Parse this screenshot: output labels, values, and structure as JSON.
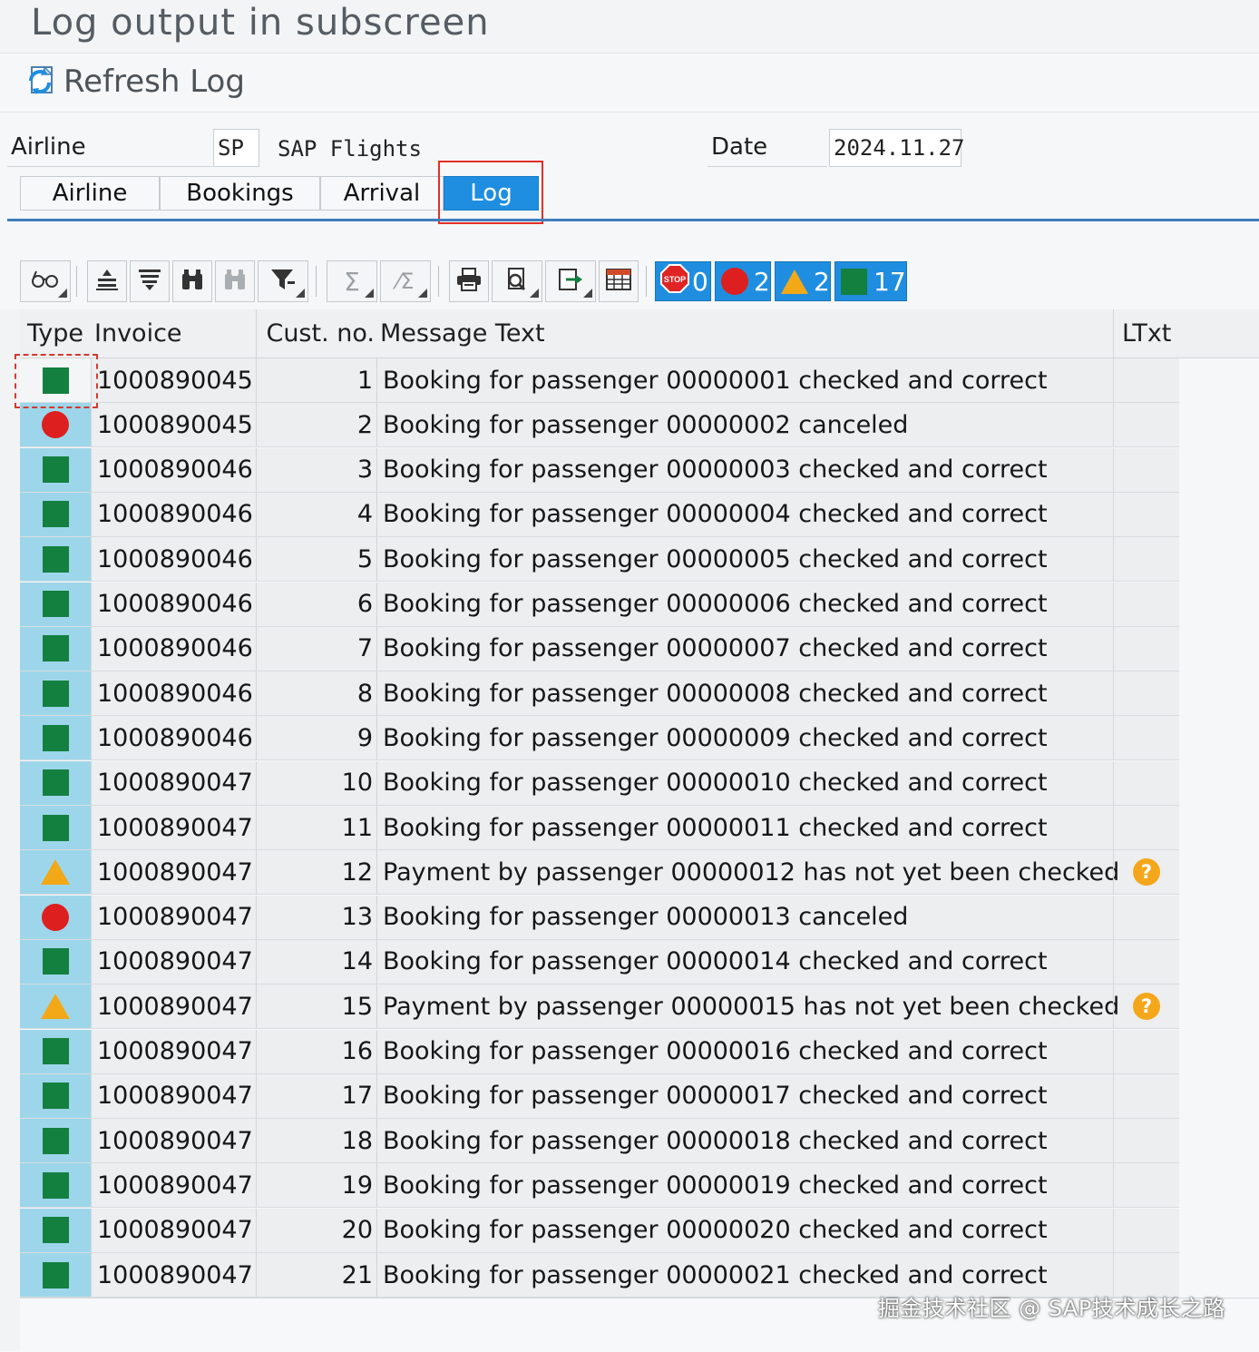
{
  "screen": {
    "title": "Log output in subscreen",
    "refresh_label": "Refresh Log"
  },
  "header": {
    "airline_label": "Airline",
    "airline_code": "SP",
    "airline_name": "SAP Flights",
    "date_label": "Date",
    "date_value": "2024.11.27"
  },
  "tabs": [
    {
      "label": "Airline",
      "active": false
    },
    {
      "label": "Bookings",
      "active": false
    },
    {
      "label": "Arrival",
      "active": false
    },
    {
      "label": "Log",
      "active": true
    }
  ],
  "toolbar": {
    "counters": {
      "stop": "0",
      "error": "2",
      "warning": "2",
      "success": "17"
    }
  },
  "grid": {
    "columns": [
      "Type",
      "Invoice",
      "Cust. no.",
      "Message Text",
      "LTxt"
    ],
    "rows": [
      {
        "type": "success",
        "invoice": "1000890045",
        "cust": "1",
        "message": "Booking for passenger 00000001 checked and correct",
        "ltxt": false
      },
      {
        "type": "error",
        "invoice": "1000890045",
        "cust": "2",
        "message": "Booking for passenger 00000002 canceled",
        "ltxt": false
      },
      {
        "type": "success",
        "invoice": "1000890046",
        "cust": "3",
        "message": "Booking for passenger 00000003 checked and correct",
        "ltxt": false
      },
      {
        "type": "success",
        "invoice": "1000890046",
        "cust": "4",
        "message": "Booking for passenger 00000004 checked and correct",
        "ltxt": false
      },
      {
        "type": "success",
        "invoice": "1000890046",
        "cust": "5",
        "message": "Booking for passenger 00000005 checked and correct",
        "ltxt": false
      },
      {
        "type": "success",
        "invoice": "1000890046",
        "cust": "6",
        "message": "Booking for passenger 00000006 checked and correct",
        "ltxt": false
      },
      {
        "type": "success",
        "invoice": "1000890046",
        "cust": "7",
        "message": "Booking for passenger 00000007 checked and correct",
        "ltxt": false
      },
      {
        "type": "success",
        "invoice": "1000890046",
        "cust": "8",
        "message": "Booking for passenger 00000008 checked and correct",
        "ltxt": false
      },
      {
        "type": "success",
        "invoice": "1000890046",
        "cust": "9",
        "message": "Booking for passenger 00000009 checked and correct",
        "ltxt": false
      },
      {
        "type": "success",
        "invoice": "1000890047",
        "cust": "10",
        "message": "Booking for passenger 00000010 checked and correct",
        "ltxt": false
      },
      {
        "type": "success",
        "invoice": "1000890047",
        "cust": "11",
        "message": "Booking for passenger 00000011 checked and correct",
        "ltxt": false
      },
      {
        "type": "warning",
        "invoice": "1000890047",
        "cust": "12",
        "message": "Payment by passenger 00000012 has not yet been checked",
        "ltxt": true
      },
      {
        "type": "error",
        "invoice": "1000890047",
        "cust": "13",
        "message": "Booking for passenger 00000013 canceled",
        "ltxt": false
      },
      {
        "type": "success",
        "invoice": "1000890047",
        "cust": "14",
        "message": "Booking for passenger 00000014 checked and correct",
        "ltxt": false
      },
      {
        "type": "warning",
        "invoice": "1000890047",
        "cust": "15",
        "message": "Payment by passenger 00000015 has not yet been checked",
        "ltxt": true
      },
      {
        "type": "success",
        "invoice": "1000890047",
        "cust": "16",
        "message": "Booking for passenger 00000016 checked and correct",
        "ltxt": false
      },
      {
        "type": "success",
        "invoice": "1000890047",
        "cust": "17",
        "message": "Booking for passenger 00000017 checked and correct",
        "ltxt": false
      },
      {
        "type": "success",
        "invoice": "1000890047",
        "cust": "18",
        "message": "Booking for passenger 00000018 checked and correct",
        "ltxt": false
      },
      {
        "type": "success",
        "invoice": "1000890047",
        "cust": "19",
        "message": "Booking for passenger 00000019 checked and correct",
        "ltxt": false
      },
      {
        "type": "success",
        "invoice": "1000890047",
        "cust": "20",
        "message": "Booking for passenger 00000020 checked and correct",
        "ltxt": false
      },
      {
        "type": "success",
        "invoice": "1000890047",
        "cust": "21",
        "message": "Booking for passenger 00000021 checked and correct",
        "ltxt": false
      }
    ]
  },
  "watermark": "掘金技术社区 @ SAP技术成长之路",
  "colors": {
    "accent": "#1f8ee0",
    "success": "#13803f",
    "error": "#dd1f1f",
    "warning": "#f2a817",
    "type_column": "#9dd6ea",
    "highlight": "#e0302a"
  }
}
